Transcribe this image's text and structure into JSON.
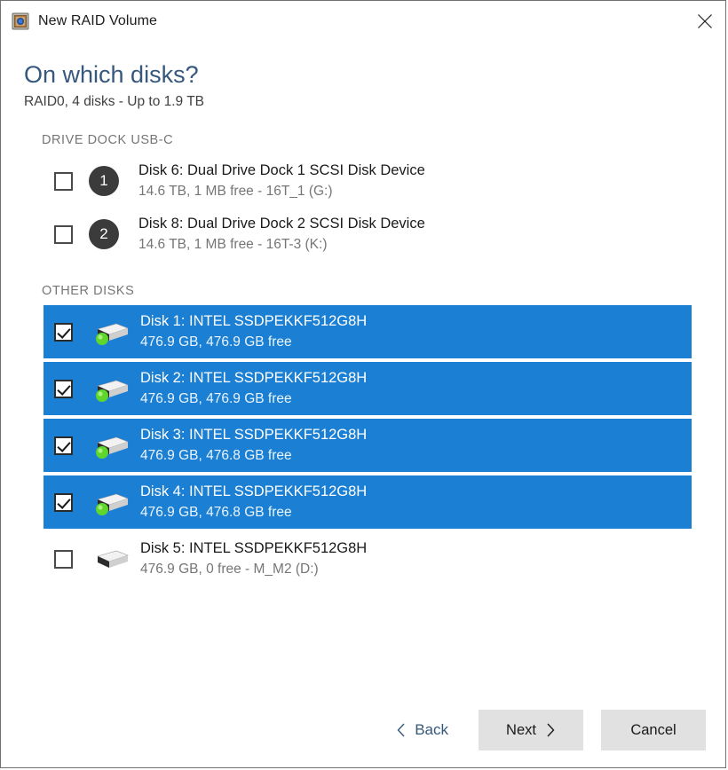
{
  "window": {
    "title": "New RAID Volume",
    "app_icon": "raid-volume-icon",
    "close_icon": "close-icon"
  },
  "header": {
    "title": "On which disks?",
    "subtitle": "RAID0, 4 disks - Up to 1.9 TB"
  },
  "sections": [
    {
      "id": "drive-dock-usb-c",
      "label": "DRIVE DOCK USB-C",
      "disks": [
        {
          "badge": "1",
          "icon": "numbered-badge-icon",
          "name": "Disk 6: Dual Drive Dock 1 SCSI Disk Device",
          "details": "14.6 TB, 1 MB free - 16T_1 (G:)",
          "checked": false
        },
        {
          "badge": "2",
          "icon": "numbered-badge-icon",
          "name": "Disk 8: Dual Drive Dock 2 SCSI Disk Device",
          "details": "14.6 TB, 1 MB free - 16T-3 (K:)",
          "checked": false
        }
      ]
    },
    {
      "id": "other-disks",
      "label": "OTHER DISKS",
      "disks": [
        {
          "icon": "drive-icon-online",
          "name": "Disk 1: INTEL SSDPEKKF512G8H",
          "details": "476.9 GB, 476.9 GB free",
          "checked": true
        },
        {
          "icon": "drive-icon-online",
          "name": "Disk 2: INTEL SSDPEKKF512G8H",
          "details": "476.9 GB, 476.9 GB free",
          "checked": true
        },
        {
          "icon": "drive-icon-online",
          "name": "Disk 3: INTEL SSDPEKKF512G8H",
          "details": "476.9 GB, 476.8 GB free",
          "checked": true
        },
        {
          "icon": "drive-icon-online",
          "name": "Disk 4: INTEL SSDPEKKF512G8H",
          "details": "476.9 GB, 476.8 GB free",
          "checked": true
        },
        {
          "icon": "drive-icon",
          "name": "Disk 5: INTEL SSDPEKKF512G8H",
          "details": "476.9 GB, 0  free - M_M2 (D:)",
          "checked": false
        }
      ]
    }
  ],
  "footer": {
    "back_label": "Back",
    "back_icon": "chevron-left-icon",
    "next_label": "Next",
    "next_icon": "chevron-right-icon",
    "cancel_label": "Cancel"
  },
  "colors": {
    "selection_blue": "#1b7fd3",
    "heading_blue": "#35587c",
    "secondary_text": "#767676",
    "button_gray": "#e1e1e1",
    "status_green": "#4cc422"
  }
}
